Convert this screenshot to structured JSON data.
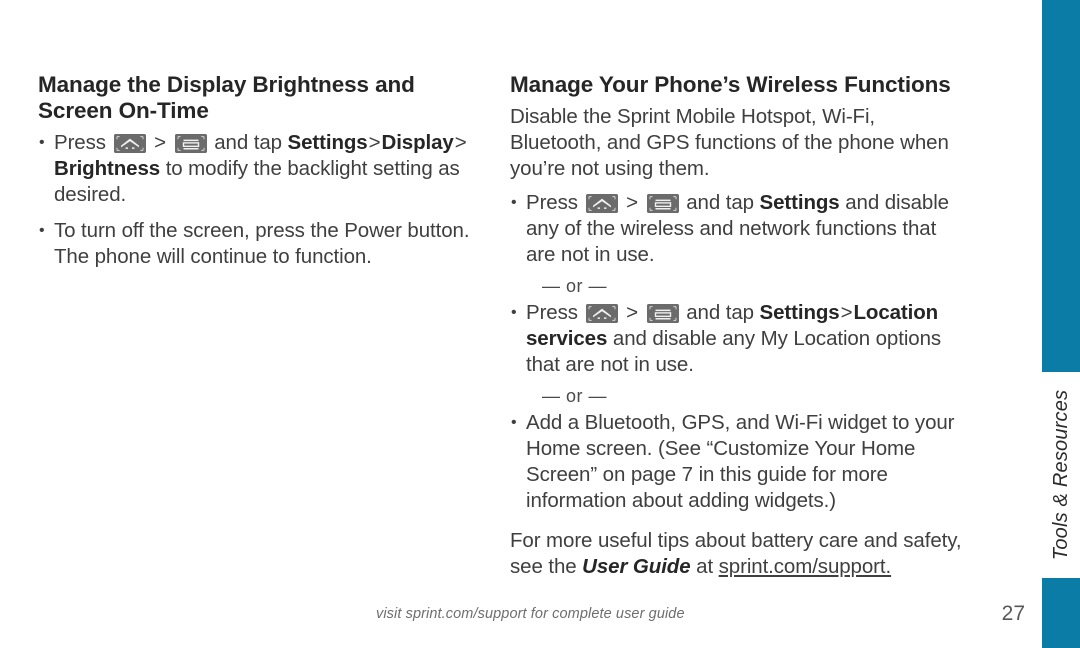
{
  "page": {
    "number": "27",
    "footer_note": "visit sprint.com/support for complete user guide"
  },
  "side_tab": {
    "label": "Tools & Resources",
    "color": "#0a7ca6"
  },
  "icons": {
    "home": "home-key-icon",
    "menu": "menu-key-icon"
  },
  "left_column": {
    "title": "Manage the Display Brightness and Screen  On-Time",
    "bullets": [
      {
        "id": "brightness",
        "seg_press": "Press",
        "seg_and_tap": "and tap",
        "seg_settings": "Settings",
        "seg_gt1": ">",
        "seg_display": "Display",
        "seg_gt2": ">",
        "seg_brightness": "Brightness",
        "seg_tail": "to modify the backlight setting as desired."
      },
      {
        "id": "power",
        "text": "To turn off the screen, press the Power button. The phone will continue to function."
      }
    ]
  },
  "right_column": {
    "title": "Manage Your Phone’s Wireless Functions",
    "intro": "Disable the Sprint Mobile Hotspot, Wi-Fi, Bluetooth, and GPS functions of the phone when you’re not using them.",
    "bullets": [
      {
        "id": "settings-disable",
        "seg_press": "Press",
        "seg_and_tap": "and tap",
        "seg_settings": "Settings",
        "seg_tail": "and disable any of the wireless and network functions that are not in use."
      },
      {
        "id": "or-1",
        "or_text": "— or —"
      },
      {
        "id": "location-services",
        "seg_press": "Press",
        "seg_and_tap": "and tap",
        "seg_settings": "Settings",
        "seg_gt1": ">",
        "seg_location": "Location services",
        "seg_tail": "and disable any My Location options that are not in use."
      },
      {
        "id": "or-2",
        "or_text": "— or —"
      },
      {
        "id": "widget",
        "text": "Add a Bluetooth, GPS, and Wi-Fi widget to your Home screen. (See “Customize Your Home Screen” on page 7 in this guide for more information about adding widgets.)"
      }
    ],
    "closing": {
      "lead": "For more useful tips about battery care and safety, see the",
      "guide_italic": "User Guide",
      "at_word": "at",
      "link": "sprint.com/support."
    }
  }
}
